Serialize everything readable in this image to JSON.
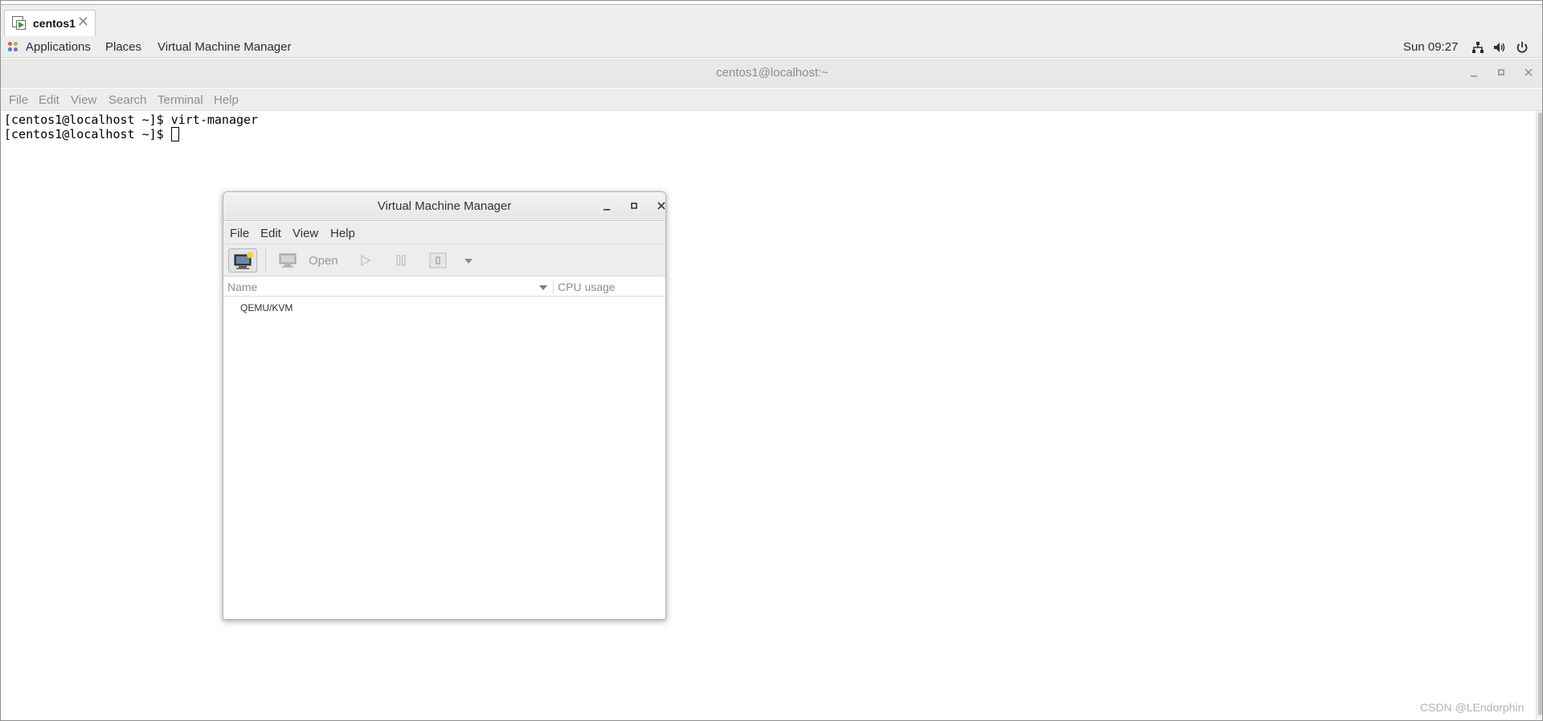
{
  "host_tab": {
    "label": "centos1",
    "close": "✕"
  },
  "topbar": {
    "applications": "Applications",
    "places": "Places",
    "vmm": "Virtual Machine Manager",
    "clock": "Sun 09:27"
  },
  "terminal": {
    "title": "centos1@localhost:~",
    "menu": [
      "File",
      "Edit",
      "View",
      "Search",
      "Terminal",
      "Help"
    ],
    "lines": [
      "[centos1@localhost ~]$ virt-manager",
      "[centos1@localhost ~]$ "
    ]
  },
  "vmm": {
    "title": "Virtual Machine Manager",
    "menu": [
      "File",
      "Edit",
      "View",
      "Help"
    ],
    "toolbar": {
      "open_label": "Open"
    },
    "columns": {
      "name": "Name",
      "cpu": "CPU usage"
    },
    "rows": [
      {
        "name": "QEMU/KVM"
      }
    ]
  },
  "watermark": "CSDN @LEndorphin",
  "icons": {
    "tab": "vm-console-icon",
    "network": "network-icon",
    "volume": "volume-icon",
    "power": "power-icon"
  }
}
